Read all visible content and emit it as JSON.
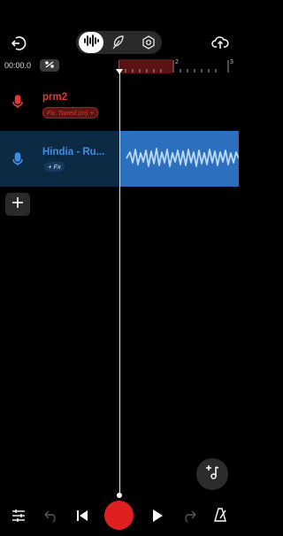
{
  "colors": {
    "background": "#000000",
    "record": "#e02020",
    "track1_accent": "#e23a3a",
    "track2_accent": "#3d8ee6",
    "waveform": "#2d6fbf",
    "ruler_region": "#5b1212"
  },
  "header": {
    "back_icon": "exit-icon",
    "modes": [
      "waveform-icon",
      "feather-icon",
      "settings-hex-icon"
    ],
    "active_mode": 0,
    "upload_icon": "cloud-upload-icon"
  },
  "timeline": {
    "time": "00:00.0",
    "ruler_ticks": [
      "2",
      "3"
    ]
  },
  "tracks": [
    {
      "name": "prm2",
      "fx_label": "Fx: Tuned (m) +"
    },
    {
      "name": "Hindia - Ru...",
      "fx_label": "+ Fx"
    }
  ],
  "footer": {
    "icons": [
      "mixer-icon",
      "undo-icon",
      "skip-back-icon",
      "record-icon",
      "play-icon",
      "redo-icon",
      "metronome-icon"
    ]
  }
}
